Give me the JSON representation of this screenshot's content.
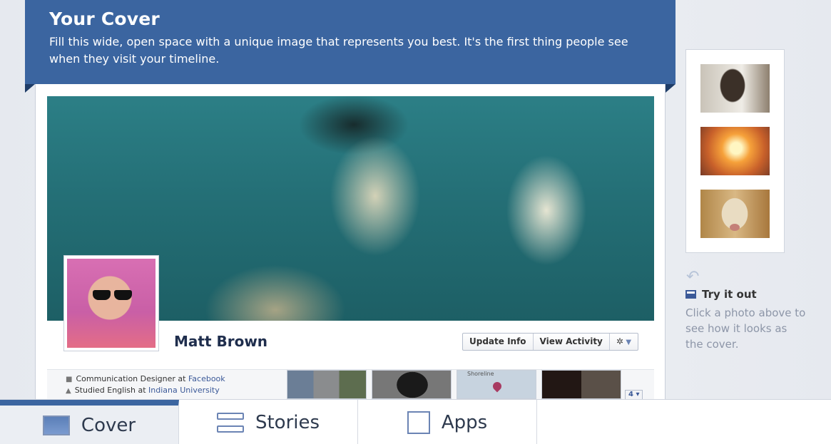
{
  "banner": {
    "title": "Your Cover",
    "text": "Fill this wide, open space with a unique image that represents you best. It's the first thing people see when they visit your timeline."
  },
  "profile": {
    "name": "Matt Brown",
    "actions": [
      "Update Info",
      "View Activity"
    ],
    "gear_label": "⚙▾"
  },
  "info": {
    "work_prefix": "Communication Designer at ",
    "work_link": "Facebook",
    "edu_prefix": "Studied English at ",
    "edu_link": "Indiana University"
  },
  "map": {
    "label": "Shoreline"
  },
  "count_badge": "4 ▾",
  "try_it": {
    "title": "Try it out",
    "desc": "Click a photo above to see how it looks as the cover."
  },
  "tabs": [
    {
      "label": "Cover",
      "active": true
    },
    {
      "label": "Stories",
      "active": false
    },
    {
      "label": "Apps",
      "active": false
    }
  ],
  "colors": {
    "accent": "#3b65a0",
    "link": "#3b5998"
  }
}
